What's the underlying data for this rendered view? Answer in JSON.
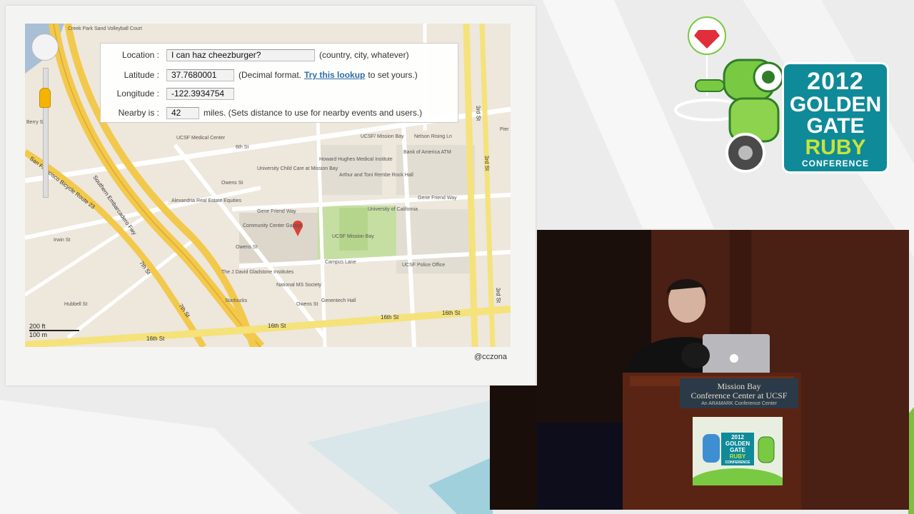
{
  "slide": {
    "form": {
      "location_label": "Location :",
      "location_value": "I can haz cheezburger?",
      "location_note": "(country, city, whatever)",
      "latitude_label": "Latitude :",
      "latitude_value": "37.7680001",
      "latitude_note_pre": "(Decimal format.",
      "latitude_link": "Try this lookup",
      "latitude_note_post": "to set yours.)",
      "longitude_label": "Longitude :",
      "longitude_value": "-122.3934754",
      "nearby_label": "Nearby is :",
      "nearby_value": "42",
      "nearby_note": "miles. (Sets distance to use for nearby events and users.)"
    },
    "handle": "@cczona",
    "map": {
      "labels": {
        "creek_park": "Creek Park Sand Volleyball Court",
        "bike_route": "San Francisco Bicycle Route 23",
        "embarcadero": "Southern Embarcadero Fwy",
        "ucsf_medical": "UCSF Medical Center",
        "ucsf_mission_bay_sta": "UCSF/ Mission Bay",
        "nelson_rising": "Nelson Rising Ln",
        "gene_friend_1": "Gene Friend Way",
        "gene_friend_2": "Gene Friend Way",
        "child_care": "University Child Care at Mission Bay",
        "alexandria": "Alexandria Real Estate Equities",
        "community_garage": "Community Center Garage",
        "ucsf_mission_bay": "UCSF Mission Bay",
        "univ_california": "University of California",
        "campus_lane": "Campus Lane",
        "ucsf_police": "UCSF Police Office",
        "gladstone": "The J David Gladstone Institutes",
        "national_ms": "National MS Society",
        "genentech": "Genentech Hall",
        "starbucks": "Starbucks",
        "st_16_a": "16th St",
        "st_16_b": "16th St",
        "st_16_c": "16th St",
        "st_16_d": "16th St",
        "st_7th_a": "7th St",
        "st_7th_b": "7th St",
        "st_3rd_a": "3rd St",
        "st_3rd_b": "3rd St",
        "st_3rd_c": "3rd St",
        "owens_a": "Owens St",
        "owens_b": "Owens St",
        "owens_c": "Owens St",
        "st_6th": "6th St",
        "hubbell": "Hubbell St",
        "irwin": "Irwin St",
        "berry": "Berry St",
        "bank_america": "Bank of America ATM",
        "howard_hughes": "Howard Hughes Medical Institute",
        "arthur_toni": "Arthur and Toni Rembe Rock Hall",
        "pier": "Pier",
        "scale_ft": "200 ft",
        "scale_m": "100 m"
      }
    }
  },
  "logo": {
    "year": "2012",
    "word1": "GOLDEN",
    "word2": "GATE",
    "word3": "RUBY",
    "word4": "CONFERENCE"
  },
  "video": {
    "sign_line1": "Mission Bay",
    "sign_line2": "Conference Center at UCSF",
    "sign_line3": "An ARAMARK Conference Center",
    "poster_year": "2012",
    "poster_w1": "GOLDEN",
    "poster_w2": "GATE",
    "poster_w3": "RUBY",
    "poster_w4": "CONFERENCE"
  },
  "colors": {
    "teal": "#0f8a98",
    "lime": "#c7e43a",
    "highway": "#f2c94c",
    "park": "#c5dfa3",
    "link": "#2f6da6"
  }
}
